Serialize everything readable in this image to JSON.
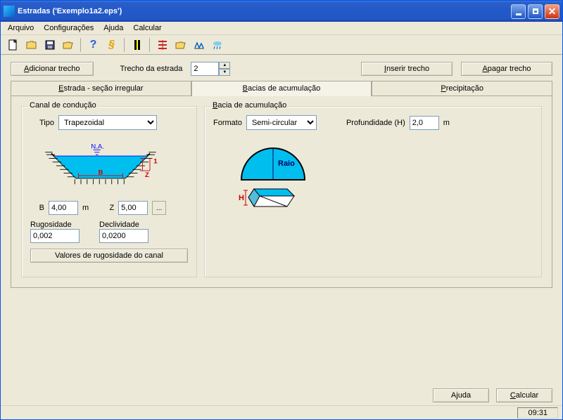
{
  "titlebar": {
    "title": "Estradas ('Exemplo1a2.eps')"
  },
  "menu": {
    "arquivo": "Arquivo",
    "config": "Configurações",
    "ajuda": "Ajuda",
    "calcular": "Calcular"
  },
  "toolbar_icons": {
    "new": "new-file-icon",
    "open": "open-folder-icon",
    "save": "save-icon",
    "saveas": "saveas-icon",
    "help": "help-icon",
    "info": "info-icon",
    "road": "road-icon",
    "sections": "sections-icon",
    "basin": "basin-icon",
    "hydro": "hydro-icon",
    "rain": "rain-icon"
  },
  "top": {
    "add": "Adicionar trecho",
    "trecho_label": "Trecho da estrada",
    "trecho_value": "2",
    "insert": "Inserir trecho",
    "delete": "Apagar trecho"
  },
  "tabs": {
    "estrada": "Estrada - seção irregular",
    "bacias": "Bacias de acumulação",
    "precip": "Precipitação"
  },
  "canal": {
    "legend": "Canal de condução",
    "tipo_label": "Tipo",
    "tipo_value": "Trapezoidal",
    "na": "N.A.",
    "b_dim": "B",
    "z_dim": "Z",
    "one": "1",
    "b_label": "B",
    "b_value": "4,00",
    "b_unit": "m",
    "z_label": "Z",
    "z_value": "5,00",
    "rug_label": "Rugosidade",
    "rug_value": "0,002",
    "decl_label": "Declividade",
    "decl_value": "0,0200",
    "rugbtn": "Valores de rugosidade do canal"
  },
  "bacia": {
    "legend": "Bacia de acumulação",
    "formato_label": "Formato",
    "formato_value": "Semi-circular",
    "prof_label": "Profundidade (H)",
    "prof_value": "2,0",
    "prof_unit": "m",
    "raio": "Raio",
    "h": "H"
  },
  "bottom": {
    "ajuda": "Ajuda",
    "calcular": "Calcular"
  },
  "status": {
    "time": "09:31"
  }
}
